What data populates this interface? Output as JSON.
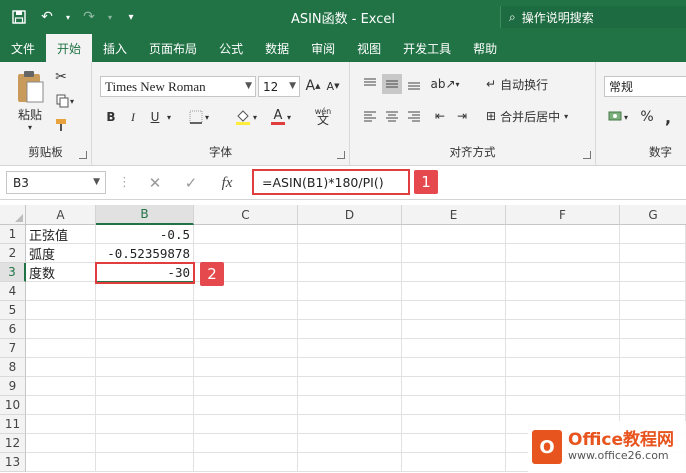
{
  "window": {
    "title": "ASIN函数 - Excel",
    "tellme": "操作说明搜索"
  },
  "ribbon": {
    "tabs": [
      "文件",
      "开始",
      "插入",
      "页面布局",
      "公式",
      "数据",
      "审阅",
      "视图",
      "开发工具",
      "帮助"
    ],
    "active_tab": "开始",
    "clipboard": {
      "paste_label": "粘贴",
      "group_label": "剪贴板"
    },
    "font": {
      "font_name": "Times New Roman",
      "font_size": "12",
      "bold": "B",
      "italic": "I",
      "underline": "U",
      "font_color_glyph": "A",
      "phonetic_glyph": "wén",
      "phonetic_glyph2": "文",
      "group_label": "字体"
    },
    "alignment": {
      "wrap_text": "自动换行",
      "merge_center": "合并后居中",
      "group_label": "对齐方式"
    },
    "number": {
      "format": "常规",
      "percent": "%",
      "comma": ",",
      "group_label": "数字"
    },
    "colors": {
      "accent": "#217346",
      "highlight": "#e03e3e"
    }
  },
  "formula_bar": {
    "name_box": "B3",
    "fx": "fx",
    "formula": "=ASIN(B1)*180/PI()"
  },
  "callouts": [
    "1",
    "2"
  ],
  "sheet": {
    "columns": [
      "A",
      "B",
      "C",
      "D",
      "E",
      "F",
      "G"
    ],
    "rows": [
      "1",
      "2",
      "3",
      "4",
      "5",
      "6",
      "7",
      "8",
      "9",
      "10",
      "11",
      "12",
      "13"
    ],
    "cells": {
      "A1": "正弦值",
      "B1": "-0.5",
      "A2": "弧度",
      "B2": "-0.52359878",
      "A3": "度数",
      "B3": "-30"
    },
    "selected": "B3"
  },
  "watermark": {
    "brand": "Office教程网",
    "url": "www.office26.com"
  }
}
